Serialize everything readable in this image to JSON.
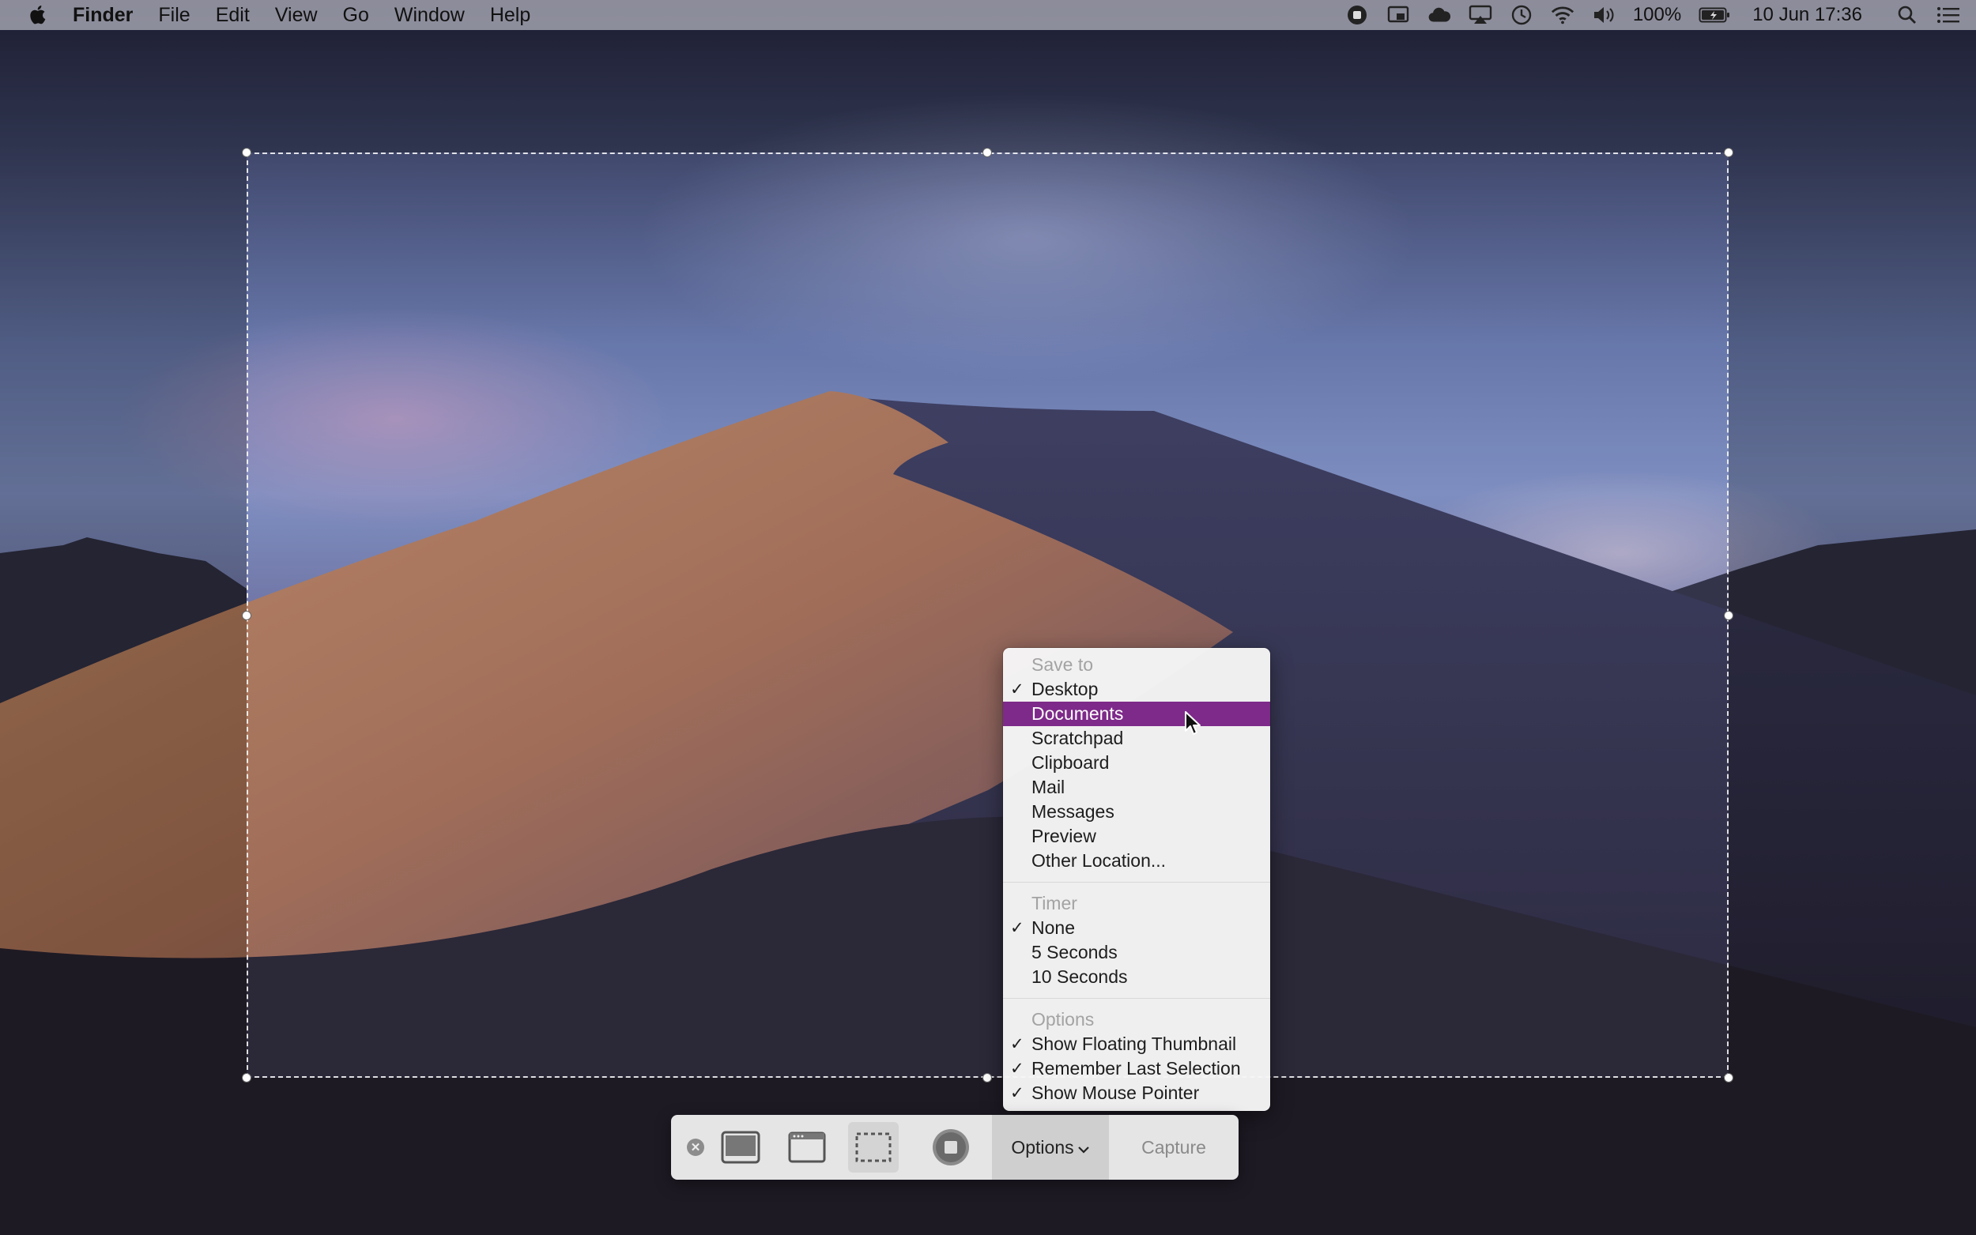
{
  "menubar": {
    "app_name": "Finder",
    "items": [
      "File",
      "Edit",
      "View",
      "Go",
      "Window",
      "Help"
    ],
    "status": {
      "battery_percent": "100%",
      "datetime": "10 Jun  17:36",
      "icons": [
        "record-icon",
        "screen-mirroring-icon",
        "cloud-icon",
        "airplay-icon",
        "time-machine-icon",
        "wifi-icon",
        "volume-icon",
        "battery-icon",
        "search-icon",
        "list-icon"
      ]
    }
  },
  "dropdown": {
    "save_to": {
      "header": "Save to",
      "items": [
        {
          "label": "Desktop",
          "checked": true
        },
        {
          "label": "Documents",
          "highlighted": true
        },
        {
          "label": "Scratchpad"
        },
        {
          "label": "Clipboard"
        },
        {
          "label": "Mail"
        },
        {
          "label": "Messages"
        },
        {
          "label": "Preview"
        },
        {
          "label": "Other Location..."
        }
      ]
    },
    "timer": {
      "header": "Timer",
      "items": [
        {
          "label": "None",
          "checked": true
        },
        {
          "label": "5 Seconds"
        },
        {
          "label": "10 Seconds"
        }
      ]
    },
    "options": {
      "header": "Options",
      "items": [
        {
          "label": "Show Floating Thumbnail",
          "checked": true
        },
        {
          "label": "Remember Last Selection",
          "checked": true
        },
        {
          "label": "Show Mouse Pointer",
          "checked": true
        }
      ]
    },
    "check_glyph": "✓",
    "highlight_color": "#7e2a8a"
  },
  "toolbar": {
    "options_label": "Options",
    "capture_label": "Capture",
    "close_glyph": "✕"
  }
}
